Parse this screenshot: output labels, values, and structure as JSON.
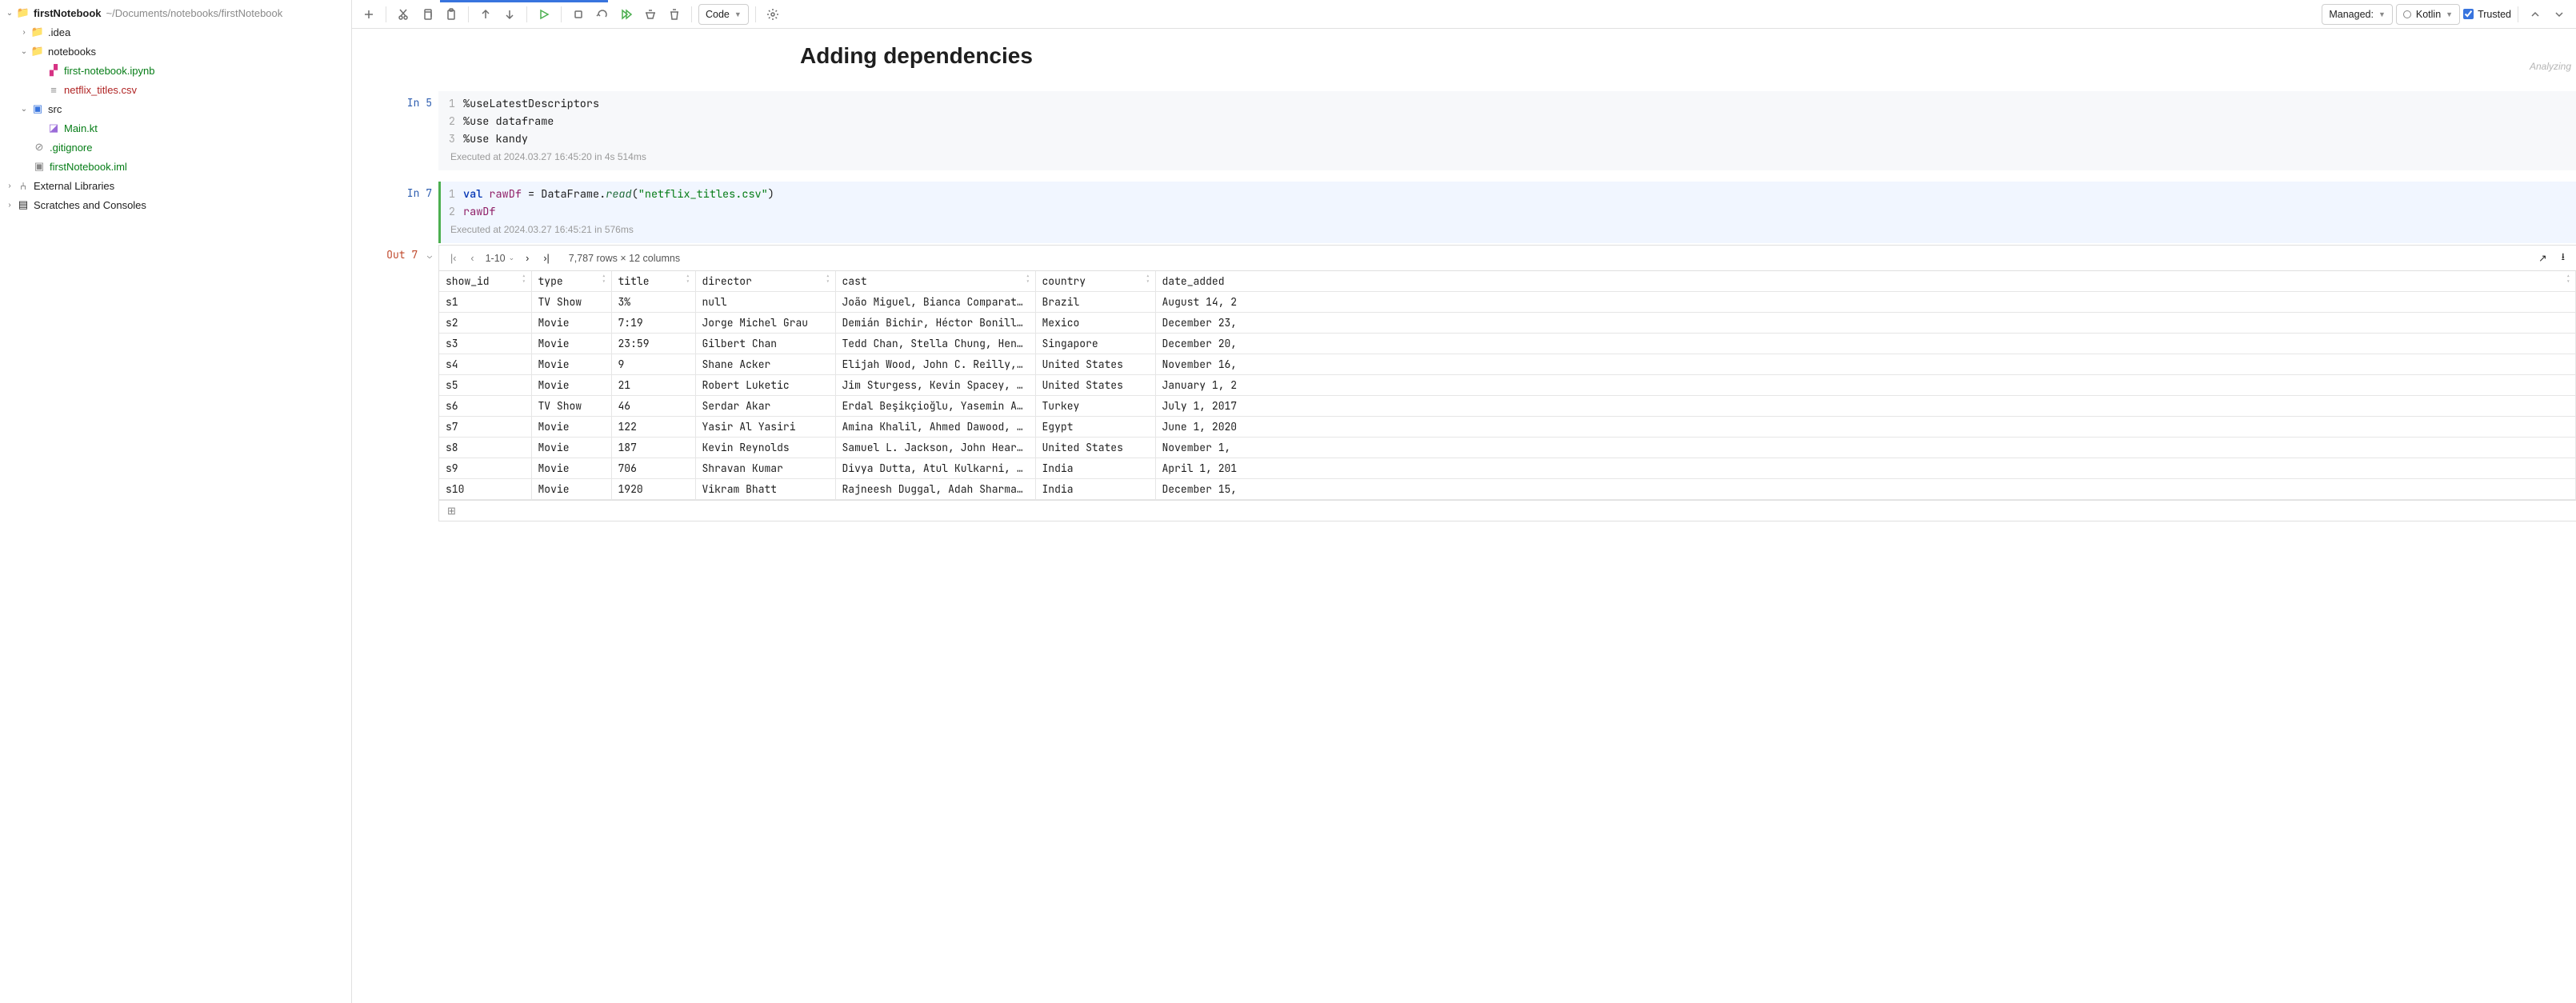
{
  "project": {
    "name": "firstNotebook",
    "path": "~/Documents/notebooks/firstNotebook",
    "tree": {
      "idea": ".idea",
      "notebooks": "notebooks",
      "first_nb": "first-notebook.ipynb",
      "netflix_csv": "netflix_titles.csv",
      "src": "src",
      "main_kt": "Main.kt",
      "gitignore": ".gitignore",
      "iml": "firstNotebook.iml",
      "ext_lib": "External Libraries",
      "scratches": "Scratches and Consoles"
    }
  },
  "toolbar": {
    "cell_type": "Code",
    "managed": "Managed:",
    "kernel": "Kotlin",
    "trusted": "Trusted"
  },
  "analyzing": "Analyzing",
  "notebook": {
    "title": "Adding dependencies",
    "cell1": {
      "prompt": "In 5",
      "line1": "%useLatestDescriptors",
      "line2": "%use dataframe",
      "line3": "%use kandy",
      "meta": "Executed at 2024.03.27 16:45:20 in 4s 514ms"
    },
    "cell2": {
      "prompt": "In 7",
      "kw": "val",
      "id": "rawDf",
      "eq": " = DataFrame.",
      "fn": "read",
      "paren_open": "(",
      "str": "\"netflix_titles.csv\"",
      "paren_close": ")",
      "line2": "rawDf",
      "meta": "Executed at 2024.03.27 16:45:21 in 576ms"
    },
    "out": {
      "prompt": "Out 7",
      "pager": "1-10",
      "summary": "7,787 rows × 12 columns"
    }
  },
  "chart_data": {
    "type": "table",
    "columns": [
      "show_id",
      "type",
      "title",
      "director",
      "cast",
      "country",
      "date_added"
    ],
    "rows": [
      [
        "s1",
        "TV Show",
        "3%",
        "null",
        "João Miguel, Bianca Comparato…",
        "Brazil",
        "August 14, 2"
      ],
      [
        "s2",
        "Movie",
        "7:19",
        "Jorge Michel Grau",
        "Demián Bichir, Héctor Bonilla…",
        "Mexico",
        "December 23,"
      ],
      [
        "s3",
        "Movie",
        "23:59",
        "Gilbert Chan",
        "Tedd Chan, Stella Chung, Henl…",
        "Singapore",
        "December 20,"
      ],
      [
        "s4",
        "Movie",
        "9",
        "Shane Acker",
        "Elijah Wood, John C. Reilly, …",
        "United States",
        "November 16,"
      ],
      [
        "s5",
        "Movie",
        "21",
        "Robert Luketic",
        "Jim Sturgess, Kevin Spacey, K…",
        "United States",
        "January 1, 2"
      ],
      [
        "s6",
        "TV Show",
        "46",
        "Serdar Akar",
        "Erdal Beşikçioğlu, Yasemin Al…",
        "Turkey",
        "July 1, 2017"
      ],
      [
        "s7",
        "Movie",
        "122",
        "Yasir Al Yasiri",
        "Amina Khalil, Ahmed Dawood, T…",
        "Egypt",
        "June 1, 2020"
      ],
      [
        "s8",
        "Movie",
        "187",
        "Kevin Reynolds",
        "Samuel L. Jackson, John Heard…",
        "United States",
        "November 1, "
      ],
      [
        "s9",
        "Movie",
        "706",
        "Shravan Kumar",
        "Divya Dutta, Atul Kulkarni, M…",
        "India",
        "April 1, 201"
      ],
      [
        "s10",
        "Movie",
        "1920",
        "Vikram Bhatt",
        "Rajneesh Duggal, Adah Sharma,…",
        "India",
        "December 15,"
      ]
    ]
  }
}
